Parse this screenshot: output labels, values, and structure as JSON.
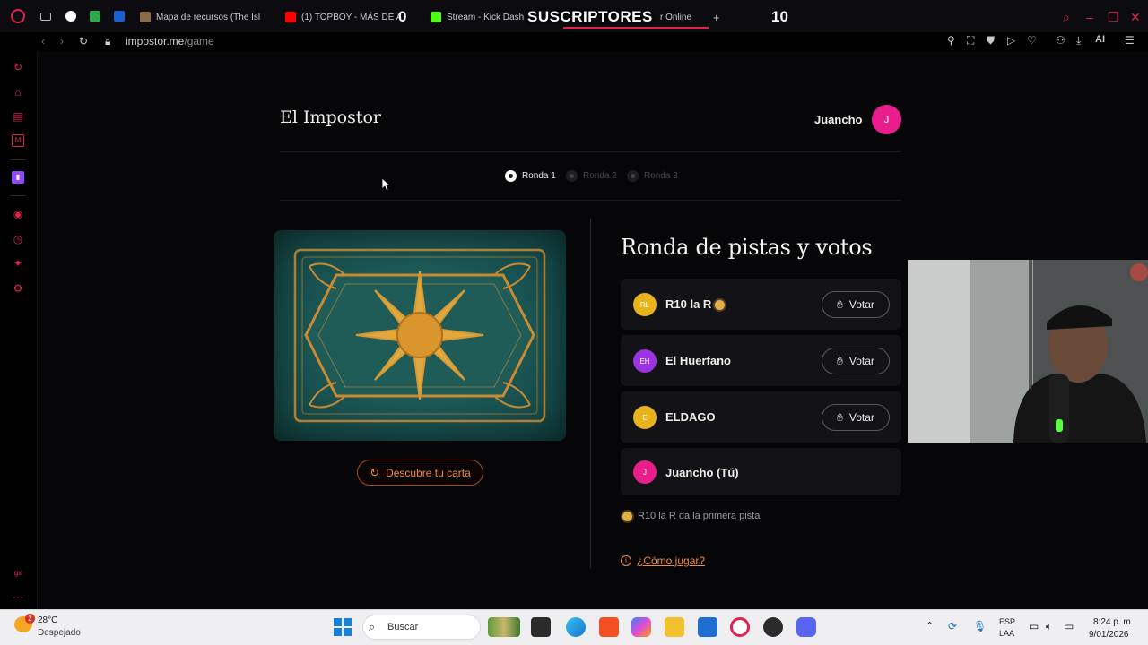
{
  "browser": {
    "tabs": [
      {
        "label": "Mapa de recursos (The Isl"
      },
      {
        "label": "(1) TOPBOY - MÁS DE A"
      },
      {
        "label": "Stream - Kick Dash"
      },
      {
        "label": "r Online"
      }
    ],
    "new_tab": "+",
    "url_domain": "impostor.me",
    "url_path": "/game",
    "ai_label": "AI",
    "accent": "#e0224e"
  },
  "stream_overlay": {
    "subs_label": "SUSCRIPTORES",
    "left_count": "0",
    "right_count": "10"
  },
  "game": {
    "title": "El Impostor",
    "user_name": "Juancho",
    "user_initial": "J",
    "rounds": [
      {
        "label": "Ronda 1",
        "active": true
      },
      {
        "label": "Ronda 2",
        "active": false
      },
      {
        "label": "Ronda 3",
        "active": false
      }
    ],
    "discover_label": "Descubre tu carta",
    "section_title": "Ronda de pistas y votos",
    "players": [
      {
        "initials": "RL",
        "name": "R10 la R",
        "color": "#e8b21a",
        "vote": "Votar",
        "first_clue": true
      },
      {
        "initials": "EH",
        "name": "El Huerfano",
        "color": "#9b34e0",
        "vote": "Votar",
        "first_clue": false
      },
      {
        "initials": "E",
        "name": "ELDAGO",
        "color": "#e8b21a",
        "vote": "Votar",
        "first_clue": false
      },
      {
        "initials": "J",
        "name": "Juancho (Tú)",
        "color": "#e91e8c",
        "vote": "",
        "first_clue": false
      }
    ],
    "hint": "R10 la R da la primera pista",
    "how_to": "¿Cómo jugar?",
    "accent": "#f08b3c"
  },
  "taskbar": {
    "weather_badge": "2",
    "weather_temp": "28°C",
    "weather_desc": "Despejado",
    "search_label": "Buscar",
    "lang_line1": "ESP",
    "lang_line2": "LAA",
    "time": "8:24 p. m.",
    "date": "9/01/2026"
  }
}
